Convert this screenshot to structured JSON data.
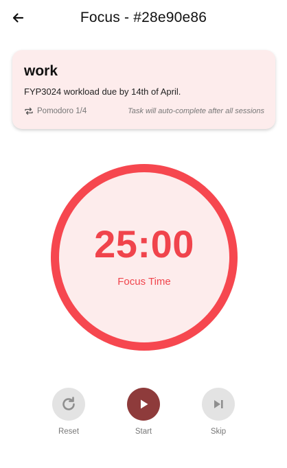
{
  "header": {
    "title": "Focus - #28e90e86",
    "back_icon": "arrow-left-icon"
  },
  "task": {
    "title": "work",
    "description": "FYP3024 workload due by 14th of April.",
    "repeat_icon": "repeat-icon",
    "pomodoro_progress": "Pomodoro 1/4",
    "auto_complete_note": "Task will auto-complete after all sessions"
  },
  "timer": {
    "value": "25:00",
    "mode": "Focus Time",
    "progress": 1.0
  },
  "controls": {
    "reset_label": "Reset",
    "start_label": "Start",
    "skip_label": "Skip"
  },
  "colors": {
    "accent": "#f6474f",
    "card_bg": "#fdecec",
    "start_button": "#8e3b3b",
    "secondary_button": "#e3e3e3"
  }
}
